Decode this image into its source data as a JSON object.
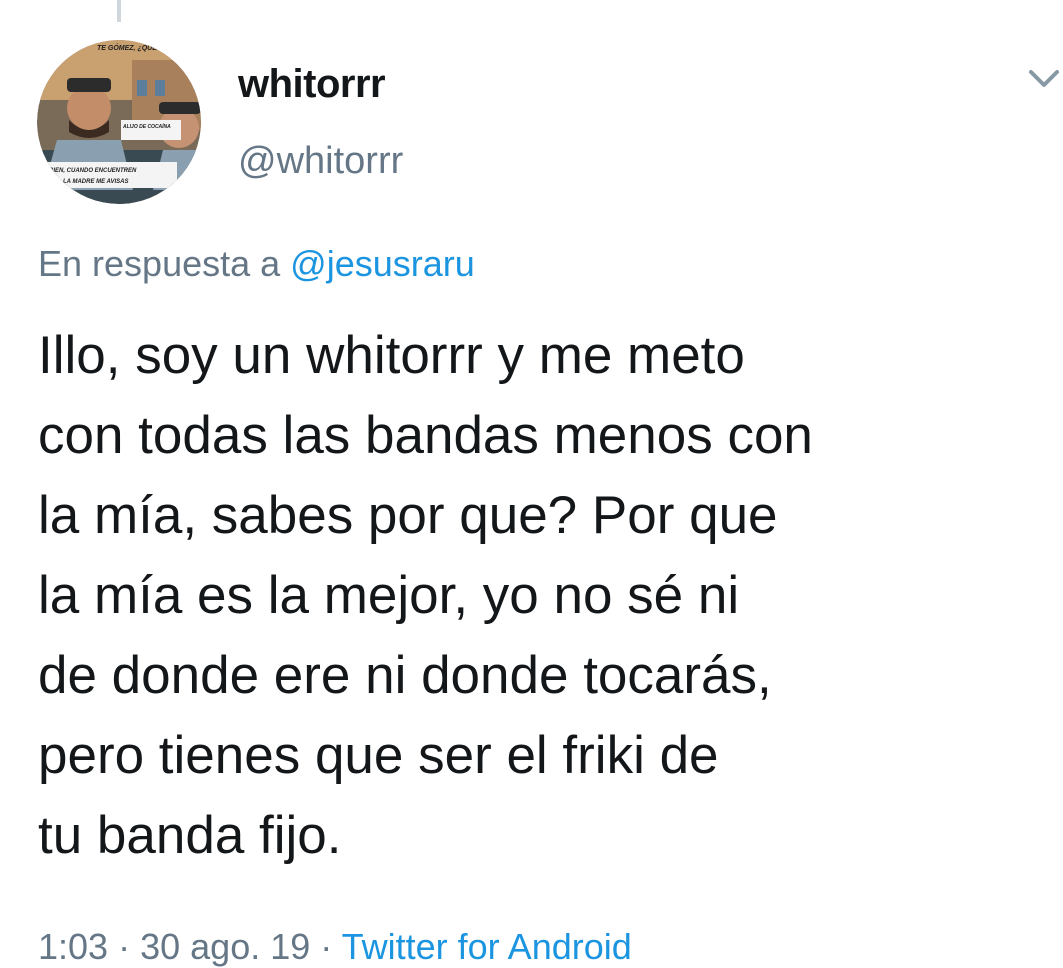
{
  "tweet": {
    "display_name": "whitorrr",
    "handle": "@whitorrr",
    "avatar": {
      "icon": "profile-avatar",
      "caption_top": "TE GÓMEZ, ¿QUÉ",
      "caption_badge": "ALIJO DE COCAÍNA",
      "caption_bottom_1": "BIEN, CUANDO ENCUENTREN",
      "caption_bottom_2": "LA MADRE ME AVISAS"
    },
    "menu_icon": "chevron-down-icon",
    "reply_prefix": "En respuesta a",
    "reply_to": "@jesusraru",
    "text_lines": [
      "Illo, soy un whitorrr y me meto",
      "con todas las bandas menos con",
      "la mía, sabes por que? Por que",
      "la mía es la mejor, yo no sé ni",
      "de donde ere ni donde tocarás,",
      "pero tienes que ser el friki de",
      "tu banda fijo."
    ],
    "time": "1:03",
    "separator": "·",
    "date": "30 ago. 19",
    "source": "Twitter for Android"
  },
  "colors": {
    "primary_text": "#14171a",
    "secondary_text": "#657786",
    "link": "#1b95e0",
    "thread_line": "#cfd6dc"
  }
}
